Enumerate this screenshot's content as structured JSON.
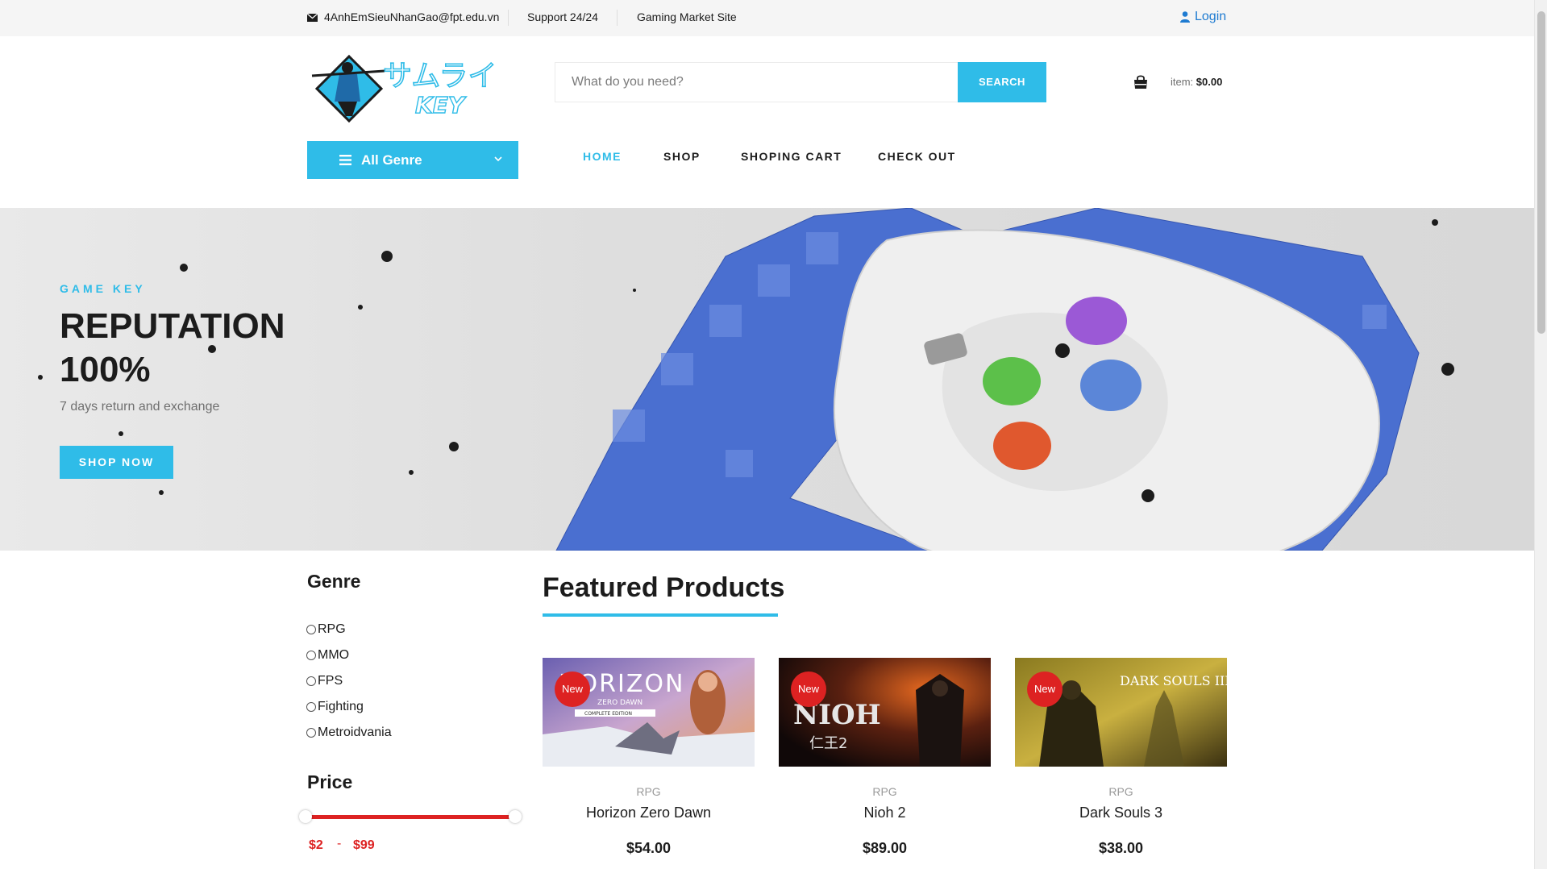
{
  "topbar": {
    "email": "4AnhEmSieuNhanGao@fpt.edu.vn",
    "support": "Support 24/24",
    "site": "Gaming Market Site",
    "login": "Login"
  },
  "logo": {
    "jp_text": "サムライ",
    "en_text": "KEY"
  },
  "search": {
    "placeholder": "What do you need?",
    "button": "SEARCH"
  },
  "cart": {
    "label": "item:",
    "total": "$0.00"
  },
  "genre_button": "All Genre",
  "nav": [
    {
      "label": "HOME",
      "active": true
    },
    {
      "label": "SHOP",
      "active": false
    },
    {
      "label": "SHOPING CART",
      "active": false
    },
    {
      "label": "CHECK OUT",
      "active": false
    }
  ],
  "hero": {
    "kicker": "GAME KEY",
    "title": "REPUTATION 100%",
    "subtitle": "7 days return and exchange",
    "button": "SHOP NOW"
  },
  "sidebar": {
    "genre_title": "Genre",
    "genres": [
      "RPG",
      "MMO",
      "FPS",
      "Fighting",
      "Metroidvania"
    ],
    "price_title": "Price",
    "price_min": "$2",
    "price_separator": "-",
    "price_max": "$99"
  },
  "featured": {
    "title": "Featured Products",
    "products": [
      {
        "badge": "New",
        "category": "RPG",
        "name": "Horizon Zero Dawn",
        "price": "$54.00",
        "art_text": "HORIZON",
        "art_sub": "ZERO DAWN",
        "art_sub2": "COMPLETE EDITION"
      },
      {
        "badge": "New",
        "category": "RPG",
        "name": "Nioh 2",
        "price": "$89.00",
        "art_text": "NIOH",
        "art_sub": "仁王2"
      },
      {
        "badge": "New",
        "category": "RPG",
        "name": "Dark Souls 3",
        "price": "$38.00",
        "art_text": "DARK SOULS III"
      }
    ]
  },
  "colors": {
    "accent": "#2fbce8",
    "sale_red": "#dd2222",
    "link_blue": "#1e7bd1"
  }
}
